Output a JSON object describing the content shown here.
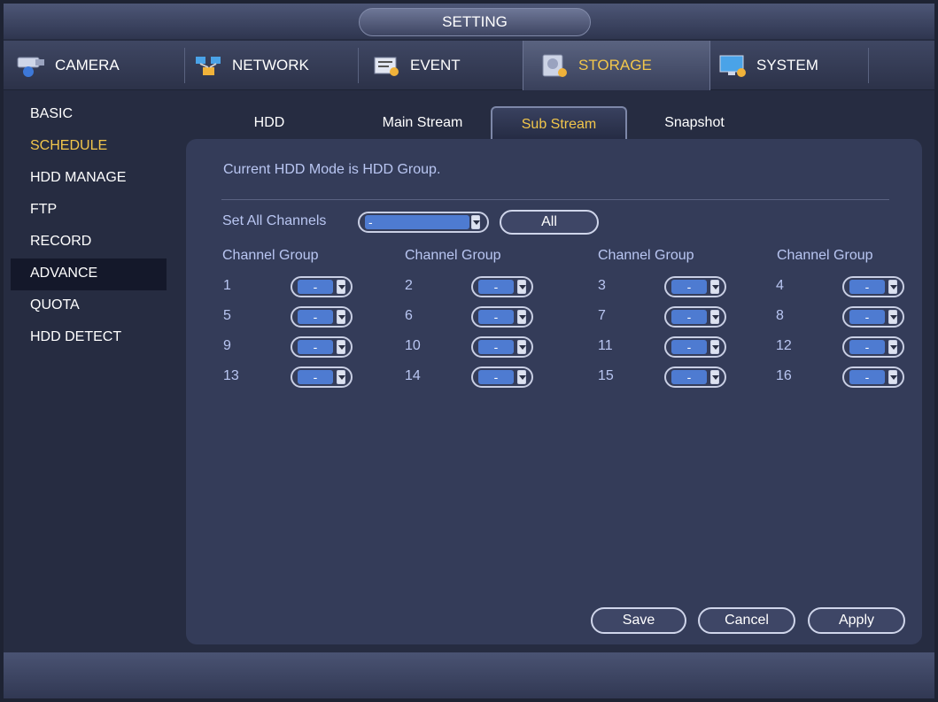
{
  "title": "SETTING",
  "topnav": [
    {
      "label": "CAMERA",
      "icon": "camera-icon"
    },
    {
      "label": "NETWORK",
      "icon": "network-icon"
    },
    {
      "label": "EVENT",
      "icon": "event-icon"
    },
    {
      "label": "STORAGE",
      "icon": "storage-icon",
      "active": true
    },
    {
      "label": "SYSTEM",
      "icon": "system-icon"
    }
  ],
  "sidebar": [
    {
      "label": "BASIC"
    },
    {
      "label": "SCHEDULE",
      "current": true
    },
    {
      "label": "HDD MANAGE"
    },
    {
      "label": "FTP"
    },
    {
      "label": "RECORD"
    },
    {
      "label": "ADVANCE",
      "selected": true
    },
    {
      "label": "QUOTA"
    },
    {
      "label": "HDD DETECT"
    }
  ],
  "subtabs": [
    {
      "label": "HDD"
    },
    {
      "label": "Main Stream"
    },
    {
      "label": "Sub Stream",
      "active": true
    },
    {
      "label": "Snapshot"
    }
  ],
  "panel": {
    "mode_text": "Current HDD Mode is HDD Group.",
    "set_all_label": "Set All Channels",
    "set_all_value": "-",
    "all_button": "All",
    "column_header": "Channel Group",
    "channels": [
      {
        "num": "1",
        "value": "-"
      },
      {
        "num": "2",
        "value": "-"
      },
      {
        "num": "3",
        "value": "-"
      },
      {
        "num": "4",
        "value": "-"
      },
      {
        "num": "5",
        "value": "-"
      },
      {
        "num": "6",
        "value": "-"
      },
      {
        "num": "7",
        "value": "-"
      },
      {
        "num": "8",
        "value": "-"
      },
      {
        "num": "9",
        "value": "-"
      },
      {
        "num": "10",
        "value": "-"
      },
      {
        "num": "11",
        "value": "-"
      },
      {
        "num": "12",
        "value": "-"
      },
      {
        "num": "13",
        "value": "-"
      },
      {
        "num": "14",
        "value": "-"
      },
      {
        "num": "15",
        "value": "-"
      },
      {
        "num": "16",
        "value": "-"
      }
    ],
    "buttons": {
      "save": "Save",
      "cancel": "Cancel",
      "apply": "Apply"
    }
  },
  "colors": {
    "accent": "#f2c64b",
    "panel": "#343c59",
    "label": "#b9c6f2",
    "value_fill": "#4e7bd1"
  }
}
